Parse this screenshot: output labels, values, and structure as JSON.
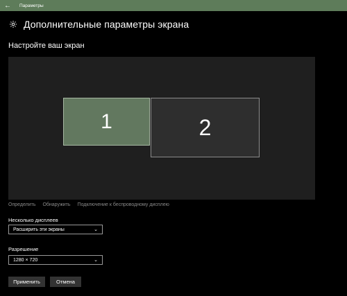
{
  "titlebar": {
    "back_icon": "back-arrow-icon",
    "app_title": "Параметры",
    "color": "#5e7c5a"
  },
  "header": {
    "icon": "gear-icon",
    "title": "Дополнительные параметры экрана"
  },
  "section": {
    "title": "Настройте ваш экран"
  },
  "monitors": [
    {
      "label": "1",
      "selected": true,
      "color": "#62785f"
    },
    {
      "label": "2",
      "selected": false,
      "color": "#2e2e2e"
    }
  ],
  "links": {
    "identify": "Определить",
    "detect": "Обнаружить",
    "wireless": "Подключение к беспроводному дисплею"
  },
  "multiple_displays": {
    "label": "Несколько дисплеев",
    "value": "Расширить эти экраны"
  },
  "resolution": {
    "label": "Разрешение",
    "value": "1280 × 720"
  },
  "buttons": {
    "apply": "Применить",
    "cancel": "Отмена"
  }
}
